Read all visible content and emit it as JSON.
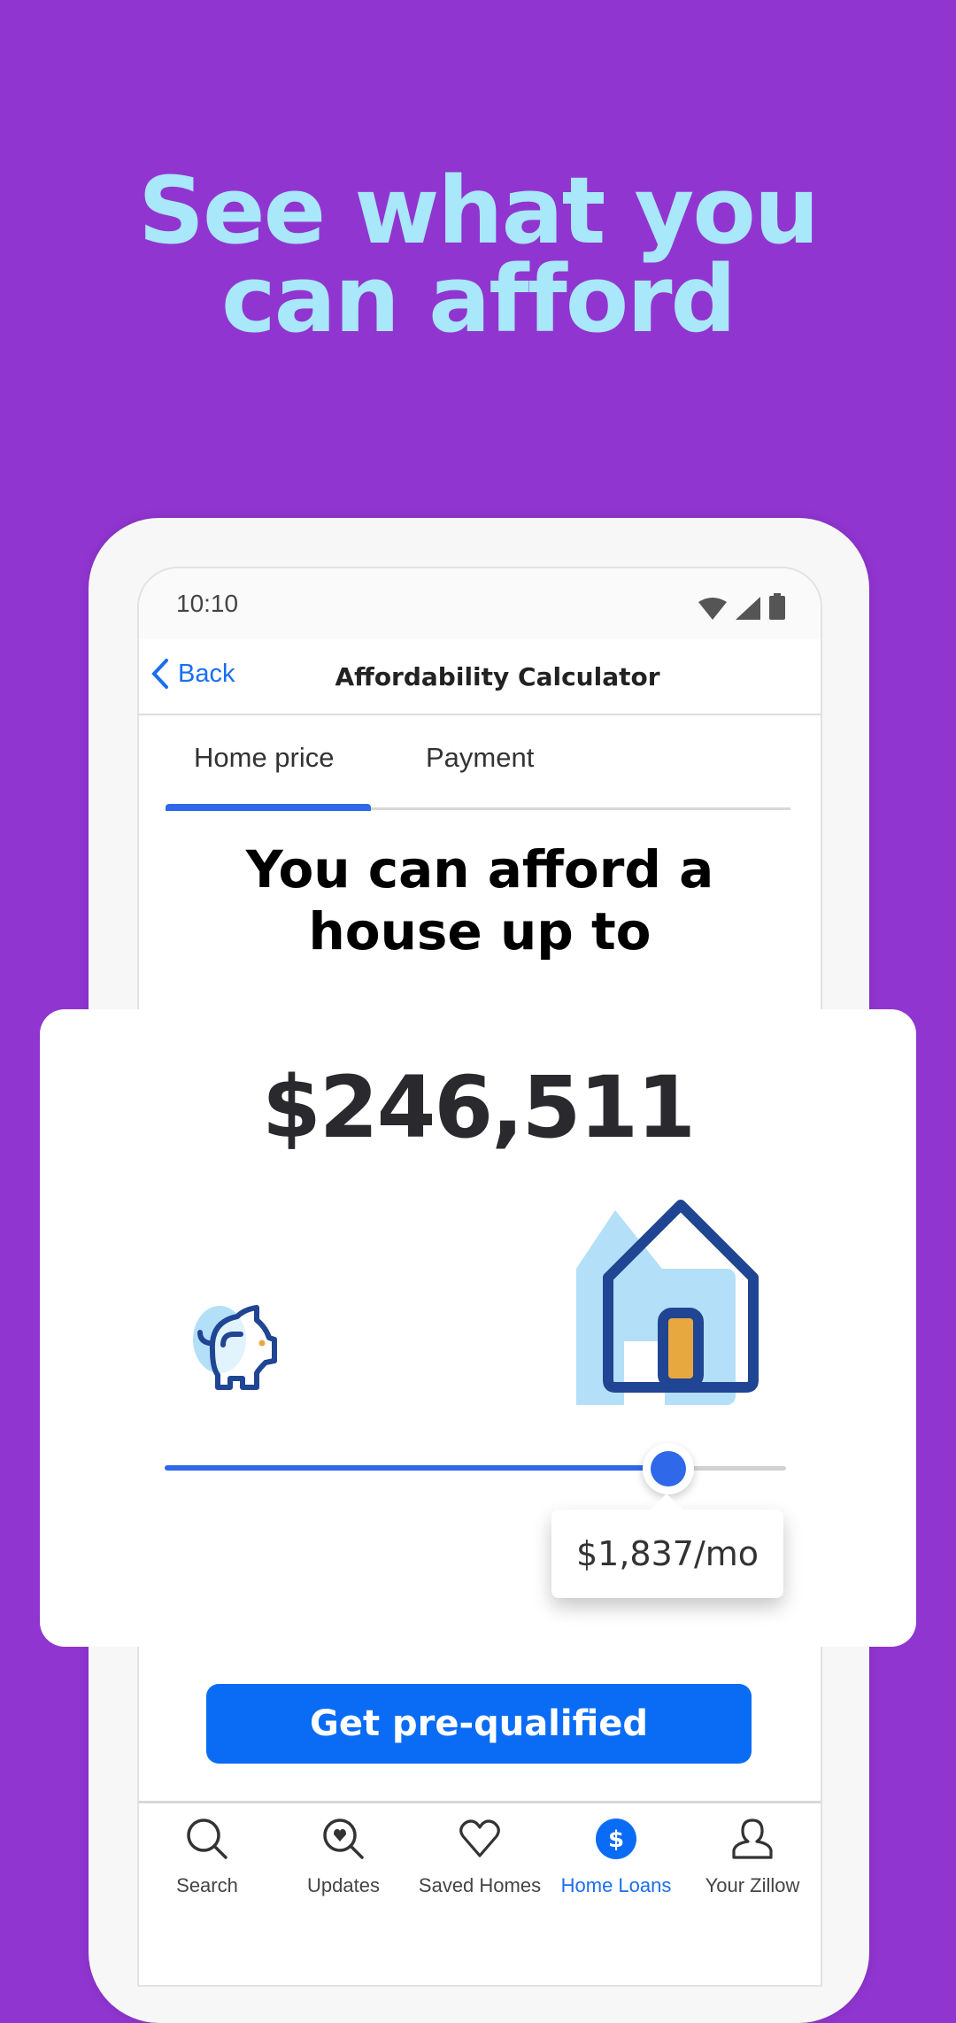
{
  "headline": {
    "line1": "See what you",
    "line2": "can afford"
  },
  "status_bar": {
    "time": "10:10",
    "icons": [
      "wifi-icon",
      "cellular-signal-icon",
      "battery-icon"
    ]
  },
  "nav": {
    "back_label": "Back",
    "title": "Affordability Calculator"
  },
  "tabs": [
    {
      "label": "Home price",
      "active": true
    },
    {
      "label": "Payment",
      "active": false
    }
  ],
  "result": {
    "heading_line1": "You can afford a",
    "heading_line2": "house up to",
    "price": "$246,511",
    "monthly_payment": "$1,837/mo",
    "slider_position": 0.81
  },
  "illustrations": {
    "left": "piggy-bank-icon",
    "right": "house-icon"
  },
  "cta": {
    "label": "Get pre-qualified"
  },
  "bottom_nav": [
    {
      "label": "Search",
      "icon": "search-icon",
      "active": false
    },
    {
      "label": "Updates",
      "icon": "updates-icon",
      "active": false
    },
    {
      "label": "Saved Homes",
      "icon": "heart-icon",
      "active": false
    },
    {
      "label": "Home Loans",
      "icon": "dollar-icon",
      "active": true
    },
    {
      "label": "Your Zillow",
      "icon": "user-icon",
      "active": false
    }
  ],
  "colors": {
    "background": "#9135d1",
    "headline": "#a9e7fb",
    "accent": "#2f68e8",
    "cta": "#0a6cf5",
    "link": "#1a6ef0",
    "illustration_dark": "#1f4593",
    "illustration_light": "#b3e0f8",
    "illustration_door": "#e8a840"
  }
}
